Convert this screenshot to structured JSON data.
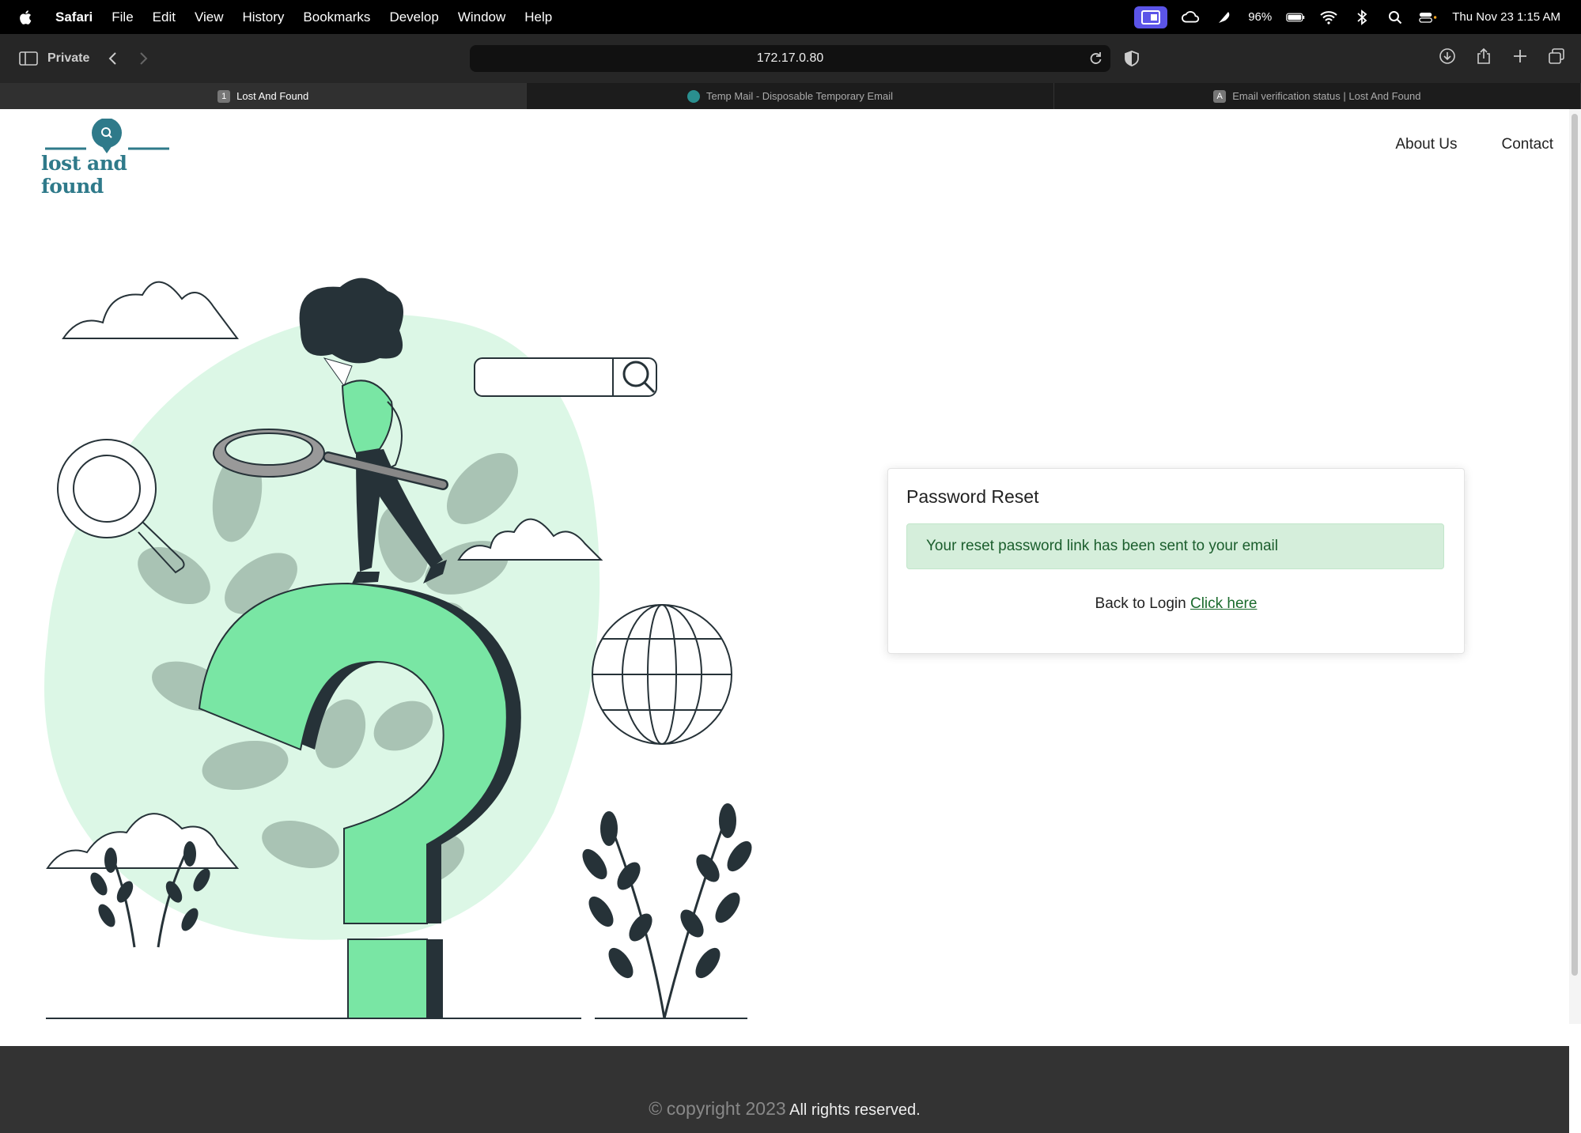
{
  "menubar": {
    "app_name": "Safari",
    "items": [
      "File",
      "Edit",
      "View",
      "History",
      "Bookmarks",
      "Develop",
      "Window",
      "Help"
    ],
    "battery": "96%",
    "datetime": "Thu Nov 23  1:15 AM"
  },
  "toolbar": {
    "private_label": "Private",
    "url": "172.17.0.80"
  },
  "tabs": [
    {
      "favicon": "1",
      "label": "Lost And Found",
      "active": true
    },
    {
      "favicon": "",
      "label": "Temp Mail - Disposable Temporary Email",
      "active": false
    },
    {
      "favicon": "A",
      "label": "Email verification status | Lost And Found",
      "active": false
    }
  ],
  "site": {
    "logo_text": "lost and found",
    "nav": {
      "about": "About Us",
      "contact": "Contact"
    }
  },
  "card": {
    "title": "Password Reset",
    "alert": "Your reset password link has been sent to your email",
    "back_text": "Back to Login",
    "back_link": "Click here"
  },
  "footer": {
    "copyright": "copyright 2023",
    "rights": "All rights reserved."
  },
  "colors": {
    "accent": "#2f7a8a",
    "illustration_green": "#79e6a4",
    "blob": "#dcf7e6",
    "dark": "#263238",
    "alert_bg": "#d5eedb",
    "footer_bg": "#333333"
  }
}
